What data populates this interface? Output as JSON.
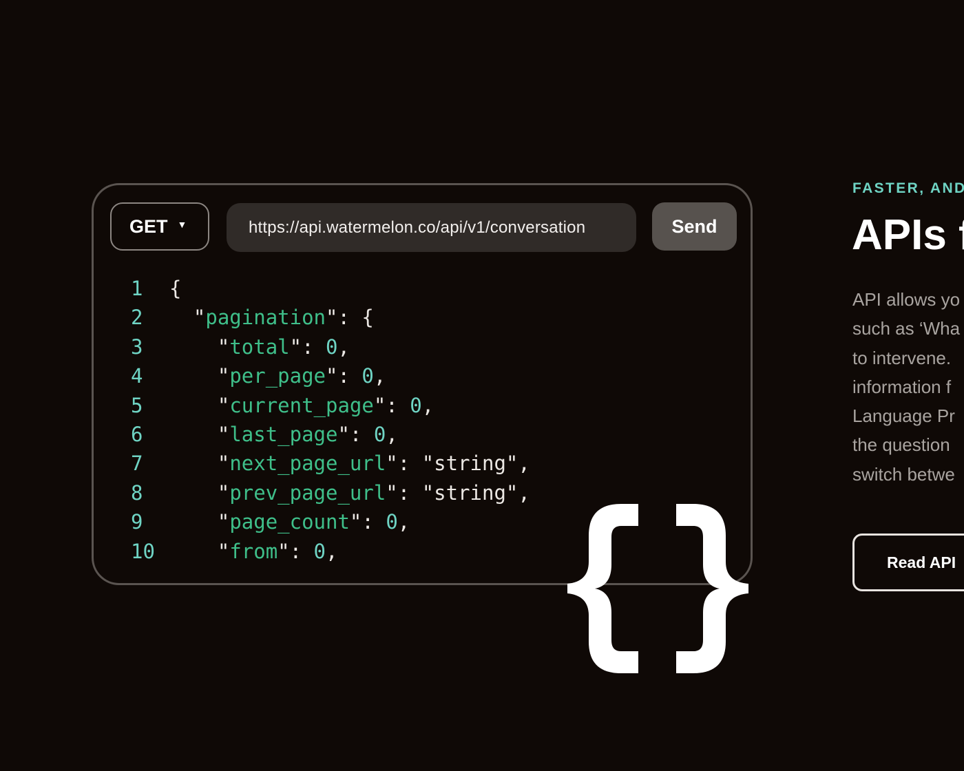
{
  "console": {
    "method": "GET",
    "url": "https://api.watermelon.co/api/v1/conversation",
    "send_label": "Send"
  },
  "code_lines": [
    {
      "num": "1",
      "indent": "",
      "parts": [
        {
          "t": "{",
          "c": "txt"
        }
      ]
    },
    {
      "num": "2",
      "indent": "  ",
      "parts": [
        {
          "t": "\"",
          "c": "txt"
        },
        {
          "t": "pagination",
          "c": "k"
        },
        {
          "t": "\": {",
          "c": "txt"
        }
      ]
    },
    {
      "num": "3",
      "indent": "    ",
      "parts": [
        {
          "t": "\"",
          "c": "txt"
        },
        {
          "t": "total",
          "c": "k"
        },
        {
          "t": "\": ",
          "c": "txt"
        },
        {
          "t": "0",
          "c": "v"
        },
        {
          "t": ",",
          "c": "txt"
        }
      ]
    },
    {
      "num": "4",
      "indent": "    ",
      "parts": [
        {
          "t": "\"",
          "c": "txt"
        },
        {
          "t": "per_page",
          "c": "k"
        },
        {
          "t": "\": ",
          "c": "txt"
        },
        {
          "t": "0",
          "c": "v"
        },
        {
          "t": ",",
          "c": "txt"
        }
      ]
    },
    {
      "num": "5",
      "indent": "    ",
      "parts": [
        {
          "t": "\"",
          "c": "txt"
        },
        {
          "t": "current_page",
          "c": "k"
        },
        {
          "t": "\": ",
          "c": "txt"
        },
        {
          "t": "0",
          "c": "v"
        },
        {
          "t": ",",
          "c": "txt"
        }
      ]
    },
    {
      "num": "6",
      "indent": "    ",
      "parts": [
        {
          "t": "\"",
          "c": "txt"
        },
        {
          "t": "last_page",
          "c": "k"
        },
        {
          "t": "\": ",
          "c": "txt"
        },
        {
          "t": "0",
          "c": "v"
        },
        {
          "t": ",",
          "c": "txt"
        }
      ]
    },
    {
      "num": "7",
      "indent": "    ",
      "parts": [
        {
          "t": "\"",
          "c": "txt"
        },
        {
          "t": "next_page_url",
          "c": "k"
        },
        {
          "t": "\": ",
          "c": "txt"
        },
        {
          "t": "\"string\"",
          "c": "s"
        },
        {
          "t": ",",
          "c": "txt"
        }
      ]
    },
    {
      "num": "8",
      "indent": "    ",
      "parts": [
        {
          "t": "\"",
          "c": "txt"
        },
        {
          "t": "prev_page_url",
          "c": "k"
        },
        {
          "t": "\": ",
          "c": "txt"
        },
        {
          "t": "\"string\"",
          "c": "s"
        },
        {
          "t": ",",
          "c": "txt"
        }
      ]
    },
    {
      "num": "9",
      "indent": "    ",
      "parts": [
        {
          "t": "\"",
          "c": "txt"
        },
        {
          "t": "page_count",
          "c": "k"
        },
        {
          "t": "\": ",
          "c": "txt"
        },
        {
          "t": "0",
          "c": "v"
        },
        {
          "t": ",",
          "c": "txt"
        }
      ]
    },
    {
      "num": "10",
      "indent": "    ",
      "parts": [
        {
          "t": "\"",
          "c": "txt"
        },
        {
          "t": "from",
          "c": "k"
        },
        {
          "t": "\": ",
          "c": "txt"
        },
        {
          "t": "0",
          "c": "v"
        },
        {
          "t": ",",
          "c": "txt"
        }
      ]
    }
  ],
  "graphic": {
    "icon": "curly-braces-icon",
    "color": "#ffffff"
  },
  "content": {
    "eyebrow": "FASTER, AND",
    "heading": "APIs f",
    "body_lines": [
      "API allows yo",
      "such as ‘Wha",
      "to intervene.",
      "information f",
      "Language Pr",
      "the question",
      "switch betwe"
    ],
    "cta_label": "Read API"
  },
  "colors": {
    "background": "#0f0906",
    "accent": "#6fd4c4",
    "key_green": "#3fbf8a",
    "panel": "#302b28",
    "send_button": "#57524e"
  }
}
